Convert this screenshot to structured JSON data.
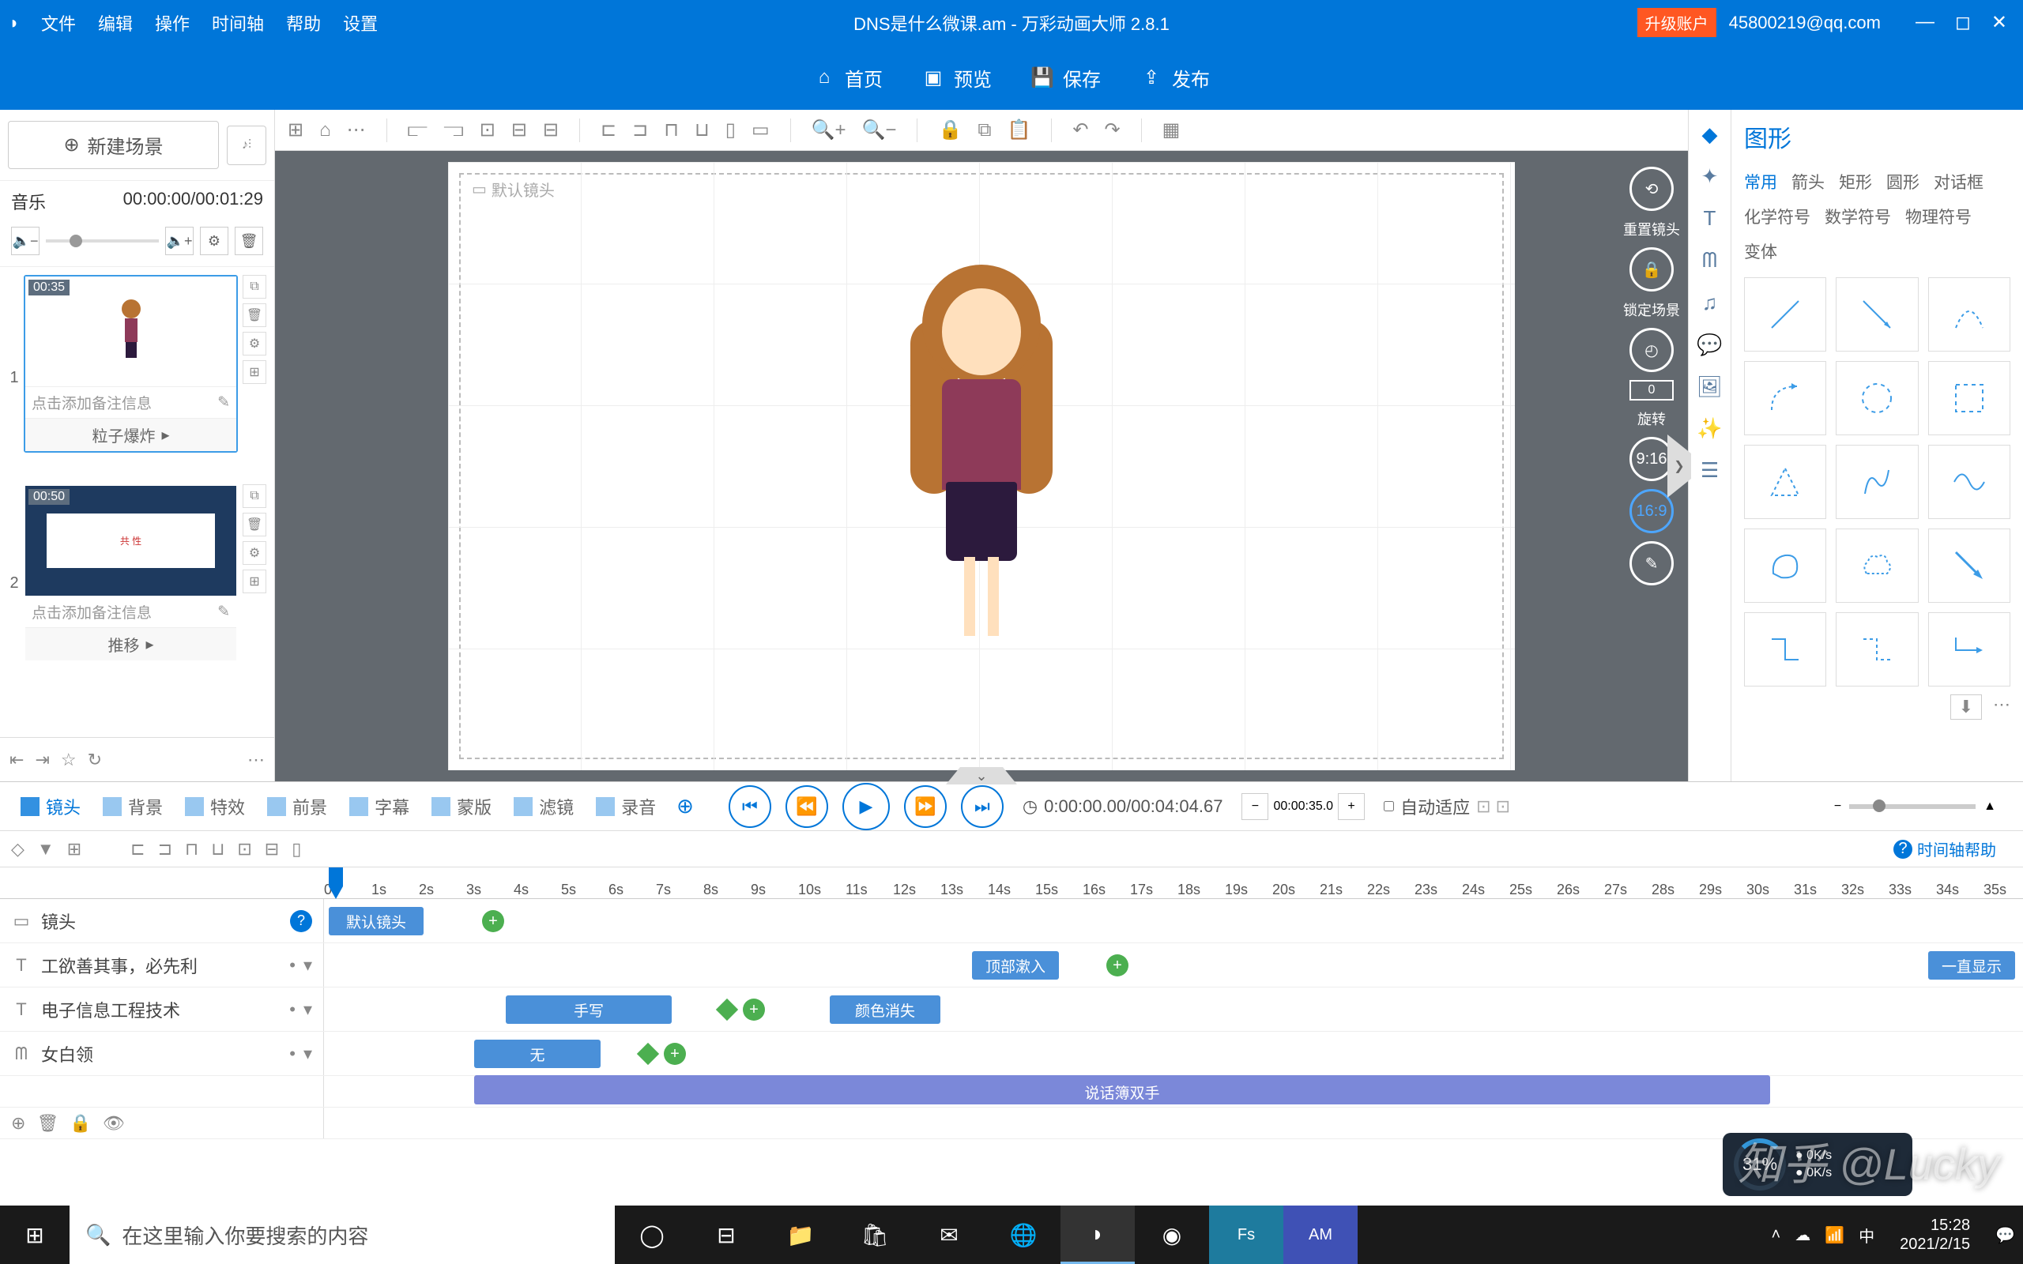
{
  "titlebar": {
    "menus": [
      "文件",
      "编辑",
      "操作",
      "时间轴",
      "帮助",
      "设置"
    ],
    "title": "DNS是什么微课.am - 万彩动画大师 2.8.1",
    "upgrade": "升级账户",
    "account": "45800219@qq.com"
  },
  "mainactions": {
    "home": "首页",
    "preview": "预览",
    "save": "保存",
    "publish": "发布"
  },
  "leftpanel": {
    "new_scene": "新建场景",
    "music_label": "音乐",
    "music_time": "00:00:00/00:01:29",
    "scenes": [
      {
        "num": "1",
        "badge": "00:35",
        "note": "点击添加备注信息",
        "transition": "粒子爆炸"
      },
      {
        "num": "2",
        "badge": "00:50",
        "note": "点击添加备注信息",
        "transition": "推移"
      }
    ]
  },
  "canvas": {
    "default_lens": "默认镜头",
    "right": {
      "reset": "重置镜头",
      "lock": "锁定场景",
      "rotate_num": "0",
      "rotate": "旋转",
      "ratio1": "9:16",
      "ratio2": "16:9"
    }
  },
  "rightpanel": {
    "title": "图形",
    "tabs": [
      "常用",
      "箭头",
      "矩形",
      "圆形",
      "对话框",
      "化学符号",
      "数学符号",
      "物理符号",
      "变体"
    ]
  },
  "timeline": {
    "tabs": [
      {
        "label": "镜头"
      },
      {
        "label": "背景"
      },
      {
        "label": "特效"
      },
      {
        "label": "前景"
      },
      {
        "label": "字幕"
      },
      {
        "label": "蒙版"
      },
      {
        "label": "滤镜"
      },
      {
        "label": "录音"
      }
    ],
    "timecode1": "0:00:00.00/00:04:04.67",
    "timecode2": "00:00:35.0",
    "autofit": "自动适应",
    "help": "时间轴帮助",
    "ruler": [
      "0s",
      "1s",
      "2s",
      "3s",
      "4s",
      "5s",
      "6s",
      "7s",
      "8s",
      "9s",
      "10s",
      "11s",
      "12s",
      "13s",
      "14s",
      "15s",
      "16s",
      "17s",
      "18s",
      "19s",
      "20s",
      "21s",
      "22s",
      "23s",
      "24s",
      "25s",
      "26s",
      "27s",
      "28s",
      "29s",
      "30s",
      "31s",
      "32s",
      "33s",
      "34s",
      "35s"
    ],
    "tracks": {
      "lens": {
        "label": "镜头",
        "clip": "默认镜头"
      },
      "text1": {
        "label": "工欲善其事，必先利",
        "clip": "顶部漱入",
        "right": "一直显示"
      },
      "text2": {
        "label": "电子信息工程技术",
        "clip1": "手写",
        "clip2": "颜色消失"
      },
      "char": {
        "label": "女白领",
        "clip1": "无",
        "clip2": "说话簿双手"
      }
    }
  },
  "taskbar": {
    "search_placeholder": "在这里输入你要搜索的内容",
    "time": "15:28",
    "date": "2021/2/15",
    "perf_pct": "31%",
    "net_up": "0K/s",
    "net_dn": "0K/s"
  },
  "watermark": "知乎 @Lucky"
}
